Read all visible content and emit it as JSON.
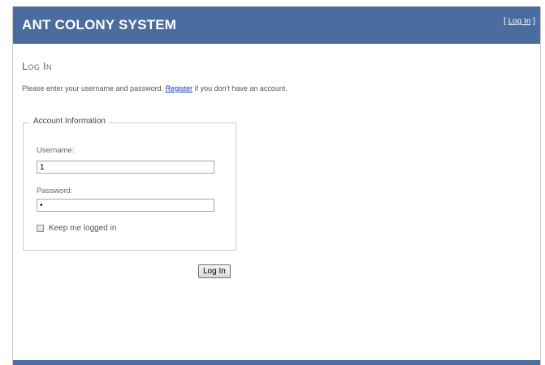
{
  "header": {
    "title": "ANT COLONY SYSTEM",
    "login_link_open": "[ ",
    "login_link_label": "Log In",
    "login_link_close": " ]"
  },
  "main": {
    "heading": "Log In",
    "intro_before": "Please enter your username and password. ",
    "register_link": "Register",
    "intro_after": "  if you don't have an account."
  },
  "form": {
    "legend": "Account Information",
    "username_label": "Username:",
    "username_value": "1",
    "password_label": "Password:",
    "password_value": "•",
    "remember_label": "Keep me logged in",
    "remember_checked": false,
    "submit_label": "Log In"
  },
  "colors": {
    "header_bg": "#4b6c9e",
    "link": "#0a36d0"
  }
}
